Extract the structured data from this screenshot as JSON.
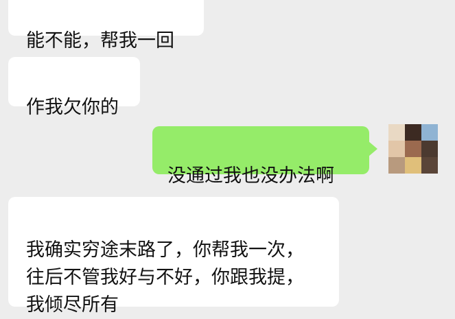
{
  "messages": [
    {
      "side": "left",
      "text": "能不能，帮我一回"
    },
    {
      "side": "left",
      "text": "作我欠你的"
    },
    {
      "side": "right",
      "text": "没通过我也没办法啊"
    },
    {
      "side": "left",
      "text": "我确实穷途末路了，你帮我一次，\n往后不管我好与不好，你跟我提，\n我倾尽所有"
    }
  ],
  "avatar": {
    "pixelated": true,
    "tile_colors": [
      "#e9d9c4",
      "#3c2a22",
      "#8fb3d3",
      "#e2c6a8",
      "#9b6a4f",
      "#4b3a30",
      "#b89a7e",
      "#e0bf7a",
      "#5a4538"
    ]
  },
  "theme": {
    "background": "#ededed",
    "incoming_bubble": "#ffffff",
    "outgoing_bubble": "#95ec69"
  }
}
